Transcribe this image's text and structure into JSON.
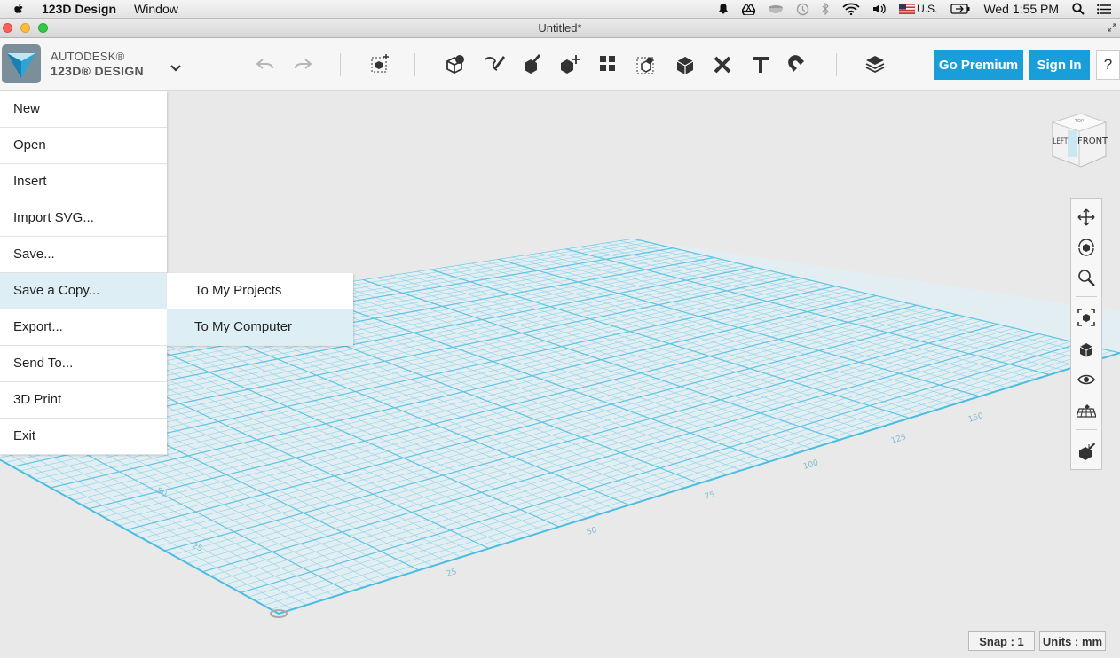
{
  "menubar": {
    "app_name": "123D Design",
    "menus": [
      "Window"
    ],
    "input_source": "U.S.",
    "clock": "Wed 1:55 PM"
  },
  "window": {
    "title": "Untitled*"
  },
  "brand": {
    "line1": "AUTODESK®",
    "line2": "123D® DESIGN"
  },
  "toolbar": {
    "go_premium_label": "Go Premium",
    "sign_in_label": "Sign In",
    "help_label": "?",
    "accent_color": "#1a9ed9"
  },
  "file_menu": {
    "items": [
      {
        "label": "New"
      },
      {
        "label": "Open"
      },
      {
        "label": "Insert"
      },
      {
        "label": "Import SVG..."
      },
      {
        "label": "Save..."
      },
      {
        "label": "Save a Copy..."
      },
      {
        "label": "Export..."
      },
      {
        "label": "Send To..."
      },
      {
        "label": "3D Print"
      },
      {
        "label": "Exit"
      }
    ]
  },
  "save_copy_submenu": {
    "items": [
      {
        "label": "To My Projects"
      },
      {
        "label": "To My Computer"
      }
    ]
  },
  "viewcube": {
    "left_face": "LEFT",
    "front_face": "FRONT",
    "top_face": "TOP"
  },
  "status": {
    "snap": "Snap : 1",
    "units": "Units : mm"
  },
  "grid": {
    "line_color": "#7ccfe6",
    "ruler_labels": [
      "25",
      "50",
      "75",
      "100",
      "125",
      "150",
      "25",
      "50"
    ]
  }
}
